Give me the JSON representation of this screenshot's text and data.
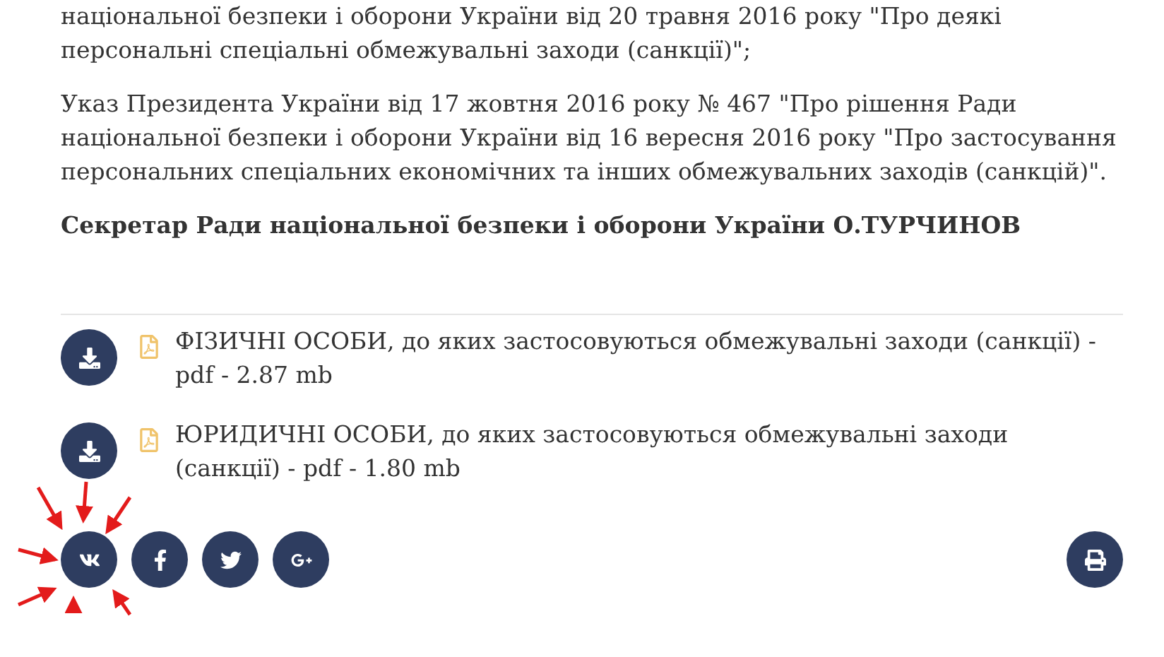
{
  "paragraphs": [
    "національної безпеки і оборони України від 20 травня 2016 року \"Про деякі персональні спеціальні обмежувальні заходи (санкції)\";",
    "Указ Президента України від 17 жовтня 2016 року № 467 \"Про рішення Ради національної безпеки і оборони України від 16 вересня 2016 року \"Про застосування персональних спеціальних економічних та інших обмежувальних заходів (санкцій)\"."
  ],
  "signature": "Секретар Ради національної безпеки і оборони України О.ТУРЧИНОВ",
  "files": [
    {
      "text": "ФІЗИЧНІ ОСОБИ, до яких застосовуються обмежувальні заходи (санкції) - pdf - 2.87 mb"
    },
    {
      "text": "ЮРИДИЧНІ ОСОБИ, до яких застосовуються обмежувальні заходи (санкції) - pdf - 1.80 mb"
    }
  ],
  "share": [
    {
      "kind": "vk",
      "annotated": true
    },
    {
      "kind": "facebook",
      "annotated": false
    },
    {
      "kind": "twitter",
      "annotated": false
    },
    {
      "kind": "googleplus",
      "annotated": false
    }
  ],
  "print": {
    "kind": "print"
  }
}
